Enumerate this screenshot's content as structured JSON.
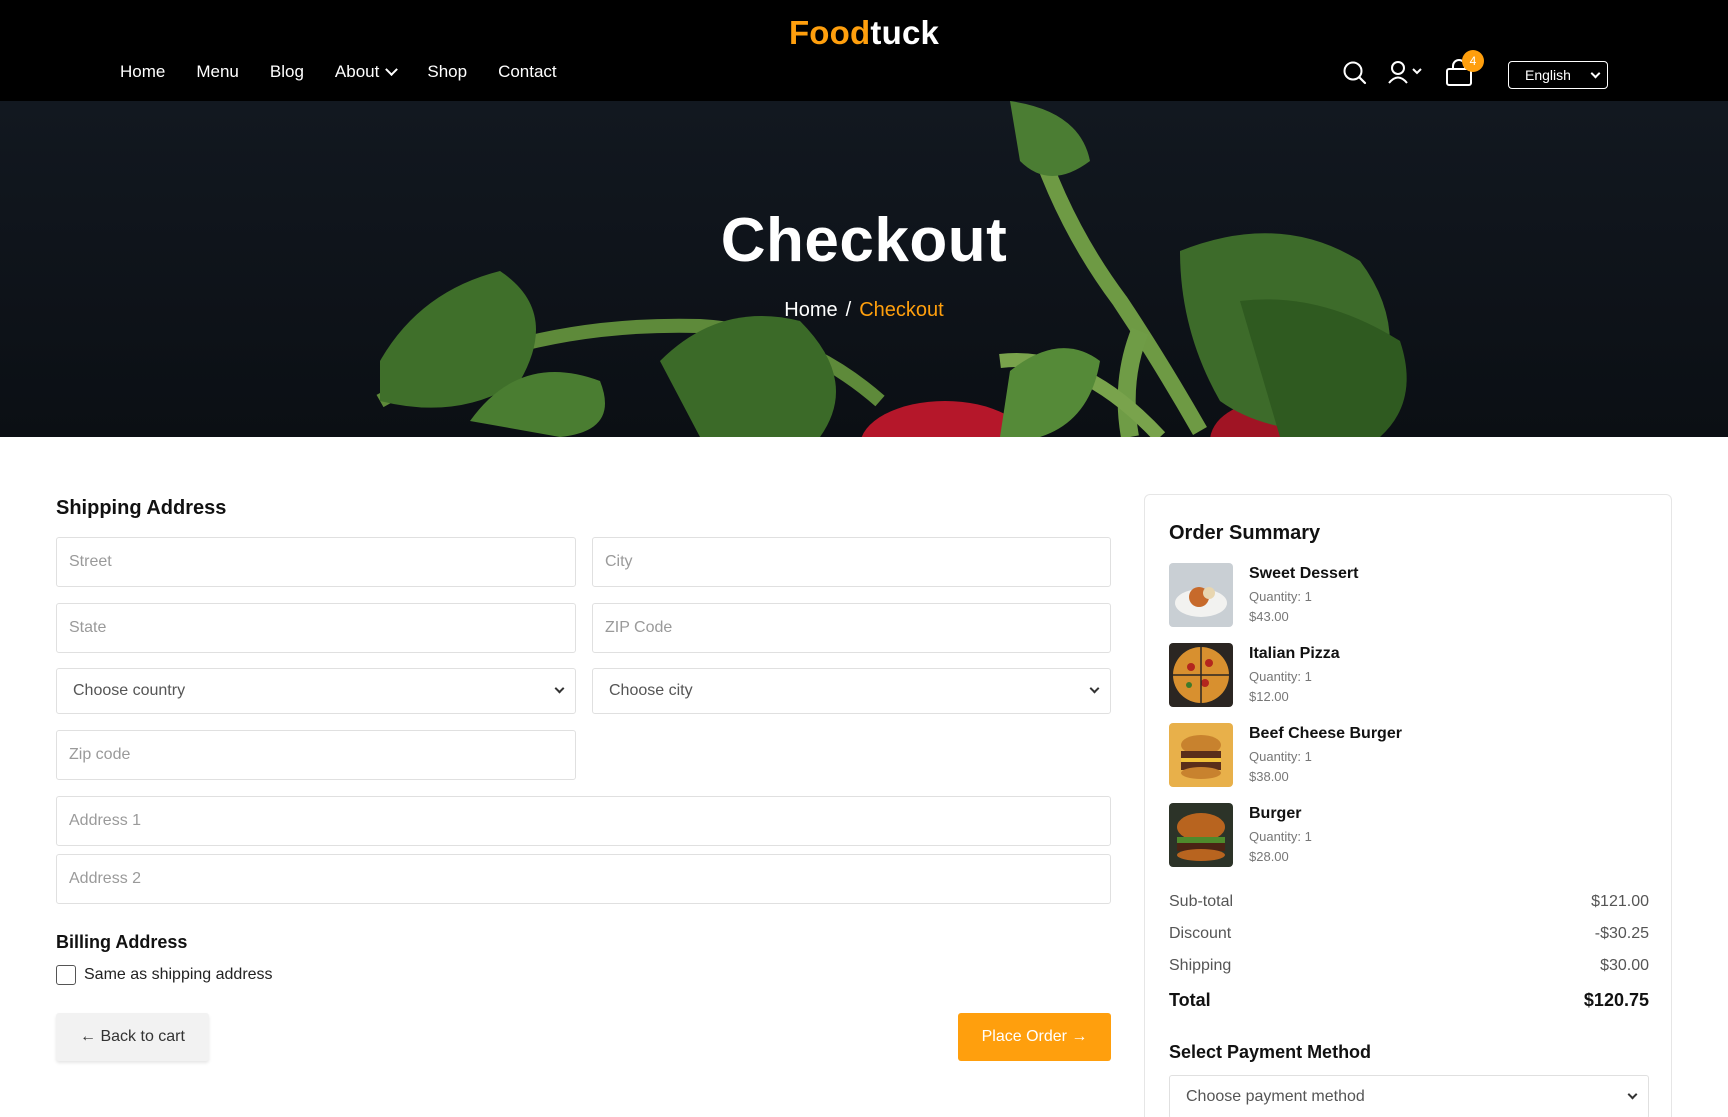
{
  "header": {
    "logo_part1": "Food",
    "logo_part2": "tuck",
    "nav": [
      "Home",
      "Menu",
      "Blog",
      "About",
      "Shop",
      "Contact"
    ],
    "cart_count": "4",
    "language": "English"
  },
  "hero": {
    "title": "Checkout",
    "breadcrumb_home": "Home",
    "breadcrumb_sep": "/",
    "breadcrumb_current": "Checkout"
  },
  "shipping": {
    "heading": "Shipping Address",
    "street_placeholder": "Street",
    "city_placeholder": "City",
    "state_placeholder": "State",
    "zip_placeholder": "ZIP Code",
    "country_select": "Choose country",
    "city_select": "Choose city",
    "zip2_placeholder": "Zip code",
    "address1_placeholder": "Address 1",
    "address2_placeholder": "Address 2"
  },
  "billing": {
    "heading": "Billing Address",
    "same_label": "Same as shipping address"
  },
  "actions": {
    "back": "← Back to cart",
    "place": "Place Order →"
  },
  "summary": {
    "title": "Order Summary",
    "items": [
      {
        "name": "Sweet Dessert",
        "qty": "Quantity: 1",
        "price": "$43.00"
      },
      {
        "name": "Italian Pizza",
        "qty": "Quantity: 1",
        "price": "$12.00"
      },
      {
        "name": "Beef Cheese Burger",
        "qty": "Quantity: 1",
        "price": "$38.00"
      },
      {
        "name": "Burger",
        "qty": "Quantity: 1",
        "price": "$28.00"
      }
    ],
    "subtotal_label": "Sub-total",
    "subtotal": "$121.00",
    "discount_label": "Discount",
    "discount": "-$30.25",
    "shipping_label": "Shipping",
    "shipping": "$30.00",
    "total_label": "Total",
    "total": "$120.75",
    "payment_heading": "Select Payment Method",
    "payment_select": "Choose payment method"
  },
  "colors": {
    "accent": "#FF9F0D",
    "header_bg": "#000000"
  }
}
